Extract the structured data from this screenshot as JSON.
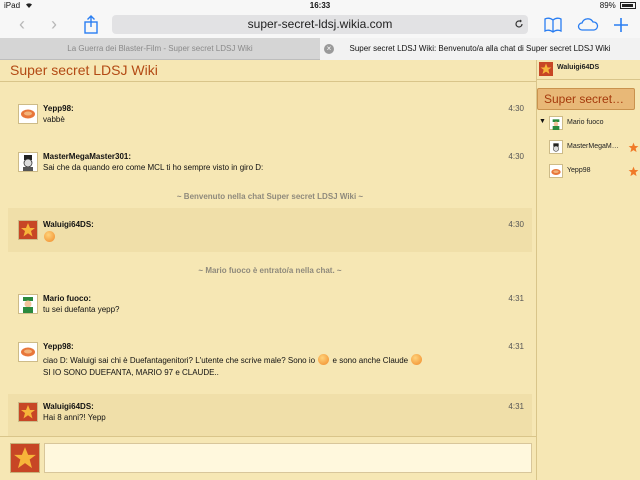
{
  "status_bar": {
    "device": "iPad",
    "time": "16:33",
    "battery": "89%"
  },
  "browser": {
    "url": "super-secret-ldsj.wikia.com",
    "tabs": [
      {
        "label": "La Guerra dei Blaster-Film - Super secret LDSJ Wiki"
      },
      {
        "label": "Super secret LDSJ Wiki: Benvenuto/a alla chat di Super secret LDSJ Wiki"
      }
    ]
  },
  "chat": {
    "wiki_title": "Super secret LDSJ Wiki",
    "messages": [
      {
        "user": "Yepp98:",
        "time": "4:30",
        "text": "vabbè"
      },
      {
        "user": "MasterMegaMaster301:",
        "time": "4:30",
        "text": "Sai che da quando ero come MCL ti ho sempre visto in giro D:"
      },
      {
        "notice": "~ Benvenuto nella chat Super secret LDSJ Wiki ~"
      },
      {
        "user": "Waluigi64DS:",
        "time": "4:30",
        "text": ""
      },
      {
        "notice": "~ Mario fuoco è entrato/a nella chat. ~"
      },
      {
        "user": "Mario fuoco:",
        "time": "4:31",
        "text": "tu sei duefanta yepp?"
      },
      {
        "user": "Yepp98:",
        "time": "4:31",
        "text_a": "ciao D: Waluigi sai chi è Duefantagenitori? L'utente che scrive male? Sono io",
        "text_b": "e sono anche Claude",
        "text_line2": "SI IO SONO DUEFANTA, MARIO 97 e CLAUDE.."
      },
      {
        "user": "Waluigi64DS:",
        "time": "4:31",
        "text": "Hai 8 anni?! Yepp"
      }
    ]
  },
  "sidebar": {
    "me": "Waluigi64DS",
    "room_label": "Super secret…",
    "users": [
      {
        "name": "Mario fuoco",
        "star": false
      },
      {
        "name": "MasterMegaM…",
        "star": true
      },
      {
        "name": "Yepp98",
        "star": true
      }
    ]
  },
  "colors": {
    "title": "#b34a14",
    "background": "#f6e7b4",
    "alt_row": "#f0dfa9",
    "star": "#f07a28"
  },
  "icons": [
    "back-icon",
    "forward-icon",
    "share-icon",
    "reload-icon",
    "bookmarks-icon",
    "cloud-icon",
    "add-tab-icon",
    "star-icon",
    "emoji-icon"
  ]
}
